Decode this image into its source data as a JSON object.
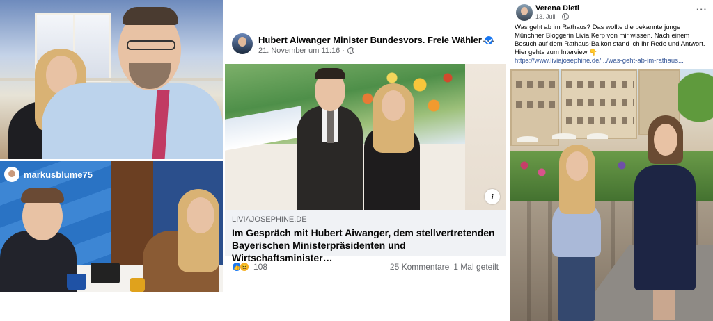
{
  "instagram_tag": {
    "username": "markusblume75"
  },
  "post_center": {
    "author": "Hubert Aiwanger Minister Bundesvors. Freie Wähler",
    "date": "21. November um 11:16 ·",
    "more": "···",
    "info": "i",
    "link_domain": "LIVIAJOSEPHINE.DE",
    "link_title": "Im Gespräch mit Hubert Aiwanger, dem stellvertretenden Bayerischen Ministerpräsidenten und Wirtschaftsminister…",
    "reactions": {
      "like": "👍",
      "haha": "😆",
      "count": "108"
    },
    "comments": "25 Kommentare",
    "shares": "1 Mal geteilt"
  },
  "post_right": {
    "author": "Verena Dietl",
    "date": "13. Juli ·",
    "more": "···",
    "text": "Was geht ab im Rathaus? Das wollte die bekannte junge Münchner Bloggerin Livia Kerp von mir wissen. Nach einem Besuch auf dem Rathaus-Balkon stand ich ihr Rede und Antwort. Hier gehts zum Interview 👇",
    "link": "https://www.liviajosephine.de/.../was-geht-ab-im-rathaus..."
  },
  "colors": {
    "facebook_blue": "#1877f2",
    "link_blue": "#385898",
    "meta_grey": "#65676b",
    "link_box_bg": "#f0f2f5"
  }
}
